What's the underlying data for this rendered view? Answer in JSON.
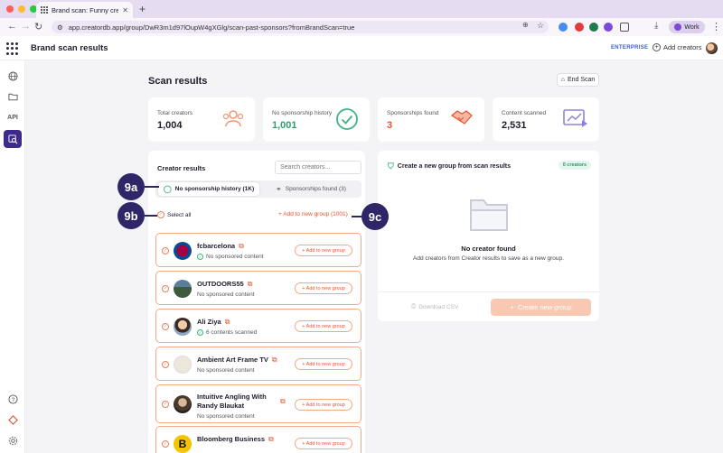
{
  "browser": {
    "tab_title": "Brand scan: Funny creators I",
    "url": "app.creatordb.app/group/DwR3m1d97lOupW4gXGlg/scan-past-sponsors?fromBrandScan=true",
    "profile_label": "Work",
    "colors": {
      "close": "#ff5f57",
      "min": "#febc2e",
      "max": "#28c840"
    }
  },
  "header": {
    "title": "Brand scan results",
    "plan_badge": "ENTERPRISE",
    "add_creators": "Add creators"
  },
  "sidebar": {
    "api_label": "API"
  },
  "scan": {
    "title": "Scan results",
    "end_scan": "End Scan"
  },
  "stats": [
    {
      "label": "Total creators",
      "value": "1,004",
      "color": "#f29a76"
    },
    {
      "label": "No sponsorship history",
      "value": "1,001",
      "color": "#2e9e6a"
    },
    {
      "label": "Sponsorships found",
      "value": "3",
      "color": "#e5532e"
    },
    {
      "label": "Content scanned",
      "value": "2,531",
      "color": "#7d72d8"
    }
  ],
  "creator_results": {
    "title": "Creator results",
    "search_placeholder": "Search creators...",
    "seg_no_sponsorship": "No sponsorship history (1K)",
    "seg_sponsorships": "Sponsorships found (3)",
    "select_all": "Select all",
    "add_all": "+ Add to new group (1001)",
    "add_button": "+ Add to new group",
    "rows": [
      {
        "name": "fcbarcelona",
        "sub": "No sponsored content"
      },
      {
        "name": "OUTDOORS55",
        "sub": "No sponsored content"
      },
      {
        "name": "Ali Ziya",
        "sub": "6 contents scanned"
      },
      {
        "name": "Ambient Art Frame TV",
        "sub": "No sponsored content"
      },
      {
        "name": "Intuitive Angling With Randy Blaukat",
        "sub": "No sponsored content"
      },
      {
        "name": "Bloomberg Business",
        "sub": ""
      }
    ]
  },
  "create_group": {
    "title": "Create a new group from scan results",
    "badge": "0 creators",
    "empty_title": "No creator found",
    "empty_sub": "Add creators from Creator results to save as a new group.",
    "download": "Download CSV",
    "create": "Create new group"
  },
  "callouts": {
    "a": "9a",
    "b": "9b",
    "c": "9c"
  }
}
